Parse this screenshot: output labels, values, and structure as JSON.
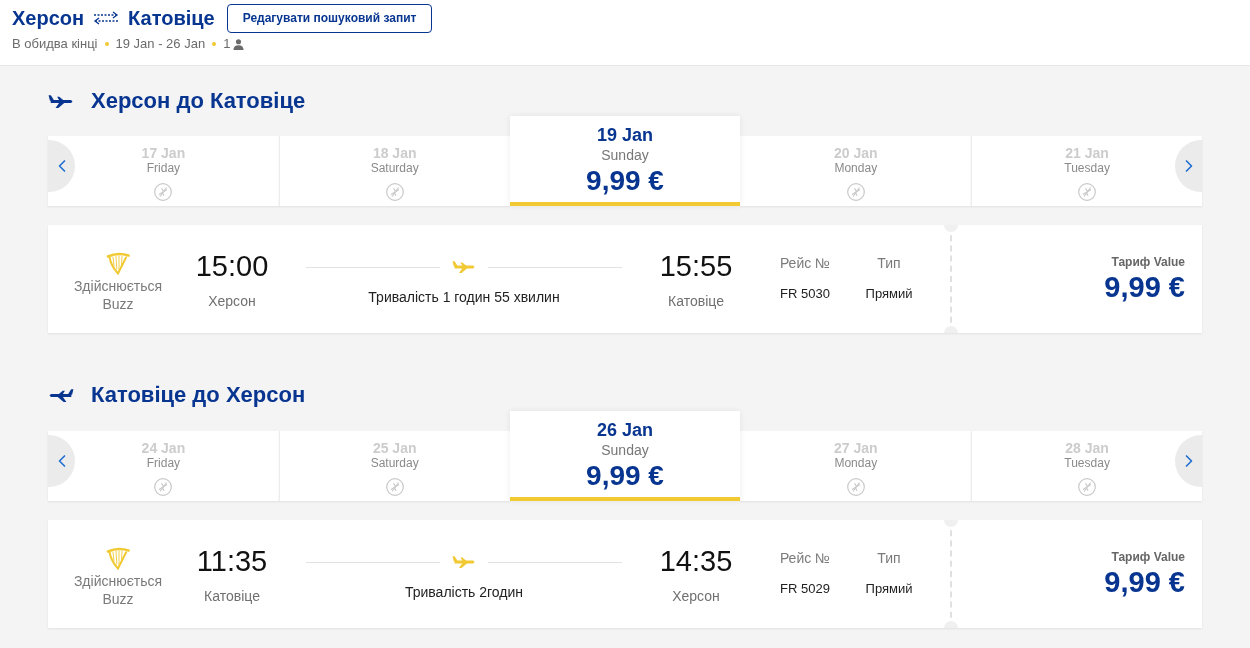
{
  "header": {
    "origin": "Херсон",
    "destination": "Катовіце",
    "edit_button": "Редагувати пошуковий запит",
    "trip_type": "В обидва кінці",
    "dates": "19 Jan - 26 Jan",
    "passengers": "1"
  },
  "journeys": [
    {
      "kind": "outbound",
      "title": "Херсон до Катовіце",
      "dates": [
        {
          "date": "17 Jan",
          "weekday": "Friday",
          "available": false,
          "selected": false
        },
        {
          "date": "18 Jan",
          "weekday": "Saturday",
          "available": false,
          "selected": false
        },
        {
          "date": "19 Jan",
          "weekday": "Sunday",
          "price": "9,99 €",
          "available": true,
          "selected": true
        },
        {
          "date": "20 Jan",
          "weekday": "Monday",
          "available": false,
          "selected": false
        },
        {
          "date": "21 Jan",
          "weekday": "Tuesday",
          "available": false,
          "selected": false
        }
      ],
      "flight": {
        "operator": "Здійснюється Buzz",
        "departure_time": "15:00",
        "departure_city": "Херсон",
        "duration": "Тривалість 1 годин 55 хвилин",
        "arrival_time": "15:55",
        "arrival_city": "Катовіце",
        "flight_number_label": "Рейс №",
        "flight_number": "FR 5030",
        "type_label": "Тип",
        "type": "Прямий",
        "fare_label": "Тариф Value",
        "fare_price": "9,99 €"
      }
    },
    {
      "kind": "return",
      "title": "Катовіце до Херсон",
      "dates": [
        {
          "date": "24 Jan",
          "weekday": "Friday",
          "available": false,
          "selected": false
        },
        {
          "date": "25 Jan",
          "weekday": "Saturday",
          "available": false,
          "selected": false
        },
        {
          "date": "26 Jan",
          "weekday": "Sunday",
          "price": "9,99 €",
          "available": true,
          "selected": true
        },
        {
          "date": "27 Jan",
          "weekday": "Monday",
          "available": false,
          "selected": false
        },
        {
          "date": "28 Jan",
          "weekday": "Tuesday",
          "available": false,
          "selected": false
        }
      ],
      "flight": {
        "operator": "Здійснюється Buzz",
        "departure_time": "11:35",
        "departure_city": "Катовіце",
        "duration": "Тривалість 2годин",
        "arrival_time": "14:35",
        "arrival_city": "Херсон",
        "flight_number_label": "Рейс №",
        "flight_number": "FR 5029",
        "type_label": "Тип",
        "type": "Прямий",
        "fare_label": "Тариф Value",
        "fare_price": "9,99 €"
      }
    }
  ]
}
